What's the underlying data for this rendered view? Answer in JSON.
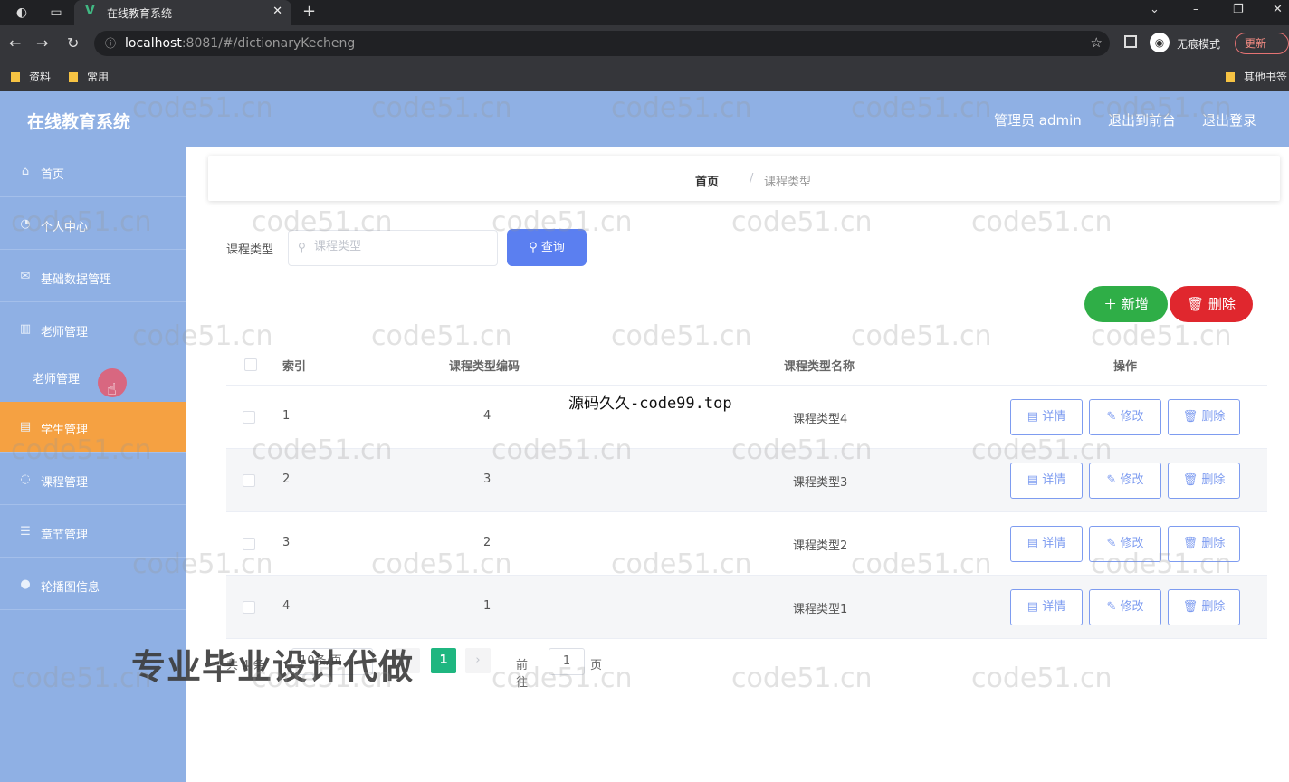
{
  "browser": {
    "tab_title": "在线教育系统",
    "tab_logo": "V",
    "url_host": "localhost",
    "url_rest": ":8081/#/dictionaryKecheng",
    "incognito_label": "无痕模式",
    "update_label": "更新",
    "bookmarks": [
      "资料",
      "常用"
    ],
    "other_bookmarks": "其他书签"
  },
  "header": {
    "title": "在线教育系统",
    "admin_label": "管理员 admin",
    "back_to_front": "退出到前台",
    "logout": "退出登录"
  },
  "sidebar": {
    "items": [
      {
        "label": "首页",
        "icon": "home-icon"
      },
      {
        "label": "个人中心",
        "icon": "user-icon"
      },
      {
        "label": "基础数据管理",
        "icon": "data-icon"
      },
      {
        "label": "老师管理",
        "icon": "chart-icon"
      },
      {
        "label": "学生管理",
        "icon": "student-icon"
      },
      {
        "label": "课程管理",
        "icon": "course-icon"
      },
      {
        "label": "章节管理",
        "icon": "list-icon"
      },
      {
        "label": "轮播图信息",
        "icon": "image-icon"
      }
    ],
    "submenu": {
      "label": "老师管理"
    }
  },
  "breadcrumb": {
    "home": "首页",
    "separator": "/",
    "current": "课程类型"
  },
  "search": {
    "label": "课程类型",
    "placeholder": "课程类型",
    "query_button": "查询"
  },
  "actions": {
    "add": "新增",
    "delete": "删除"
  },
  "table": {
    "headers": {
      "index": "索引",
      "code": "课程类型编码",
      "name": "课程类型名称",
      "ops": "操作"
    },
    "rows": [
      {
        "index": "1",
        "code": "4",
        "name": "课程类型4"
      },
      {
        "index": "2",
        "code": "3",
        "name": "课程类型3"
      },
      {
        "index": "3",
        "code": "2",
        "name": "课程类型2"
      },
      {
        "index": "4",
        "code": "1",
        "name": "课程类型1"
      }
    ],
    "ops": {
      "detail": "详情",
      "edit": "修改",
      "delete": "删除"
    }
  },
  "pagination": {
    "total": "共 4 条",
    "page_size": "10条/页",
    "current_page": "1",
    "goto_label": "前往",
    "goto_value": "1",
    "page_suffix": "页"
  },
  "overlays": {
    "ad_text": "专业毕业设计代做",
    "code99": "源码久久-code99.top",
    "watermark": "code51.cn"
  },
  "colors": {
    "header_bg": "#8fb0e4",
    "active_menu": "#f5a142",
    "query_btn": "#5b7ff0",
    "add_btn": "#2fae47",
    "delete_btn": "#e0272e",
    "page_active": "#1fb680"
  }
}
